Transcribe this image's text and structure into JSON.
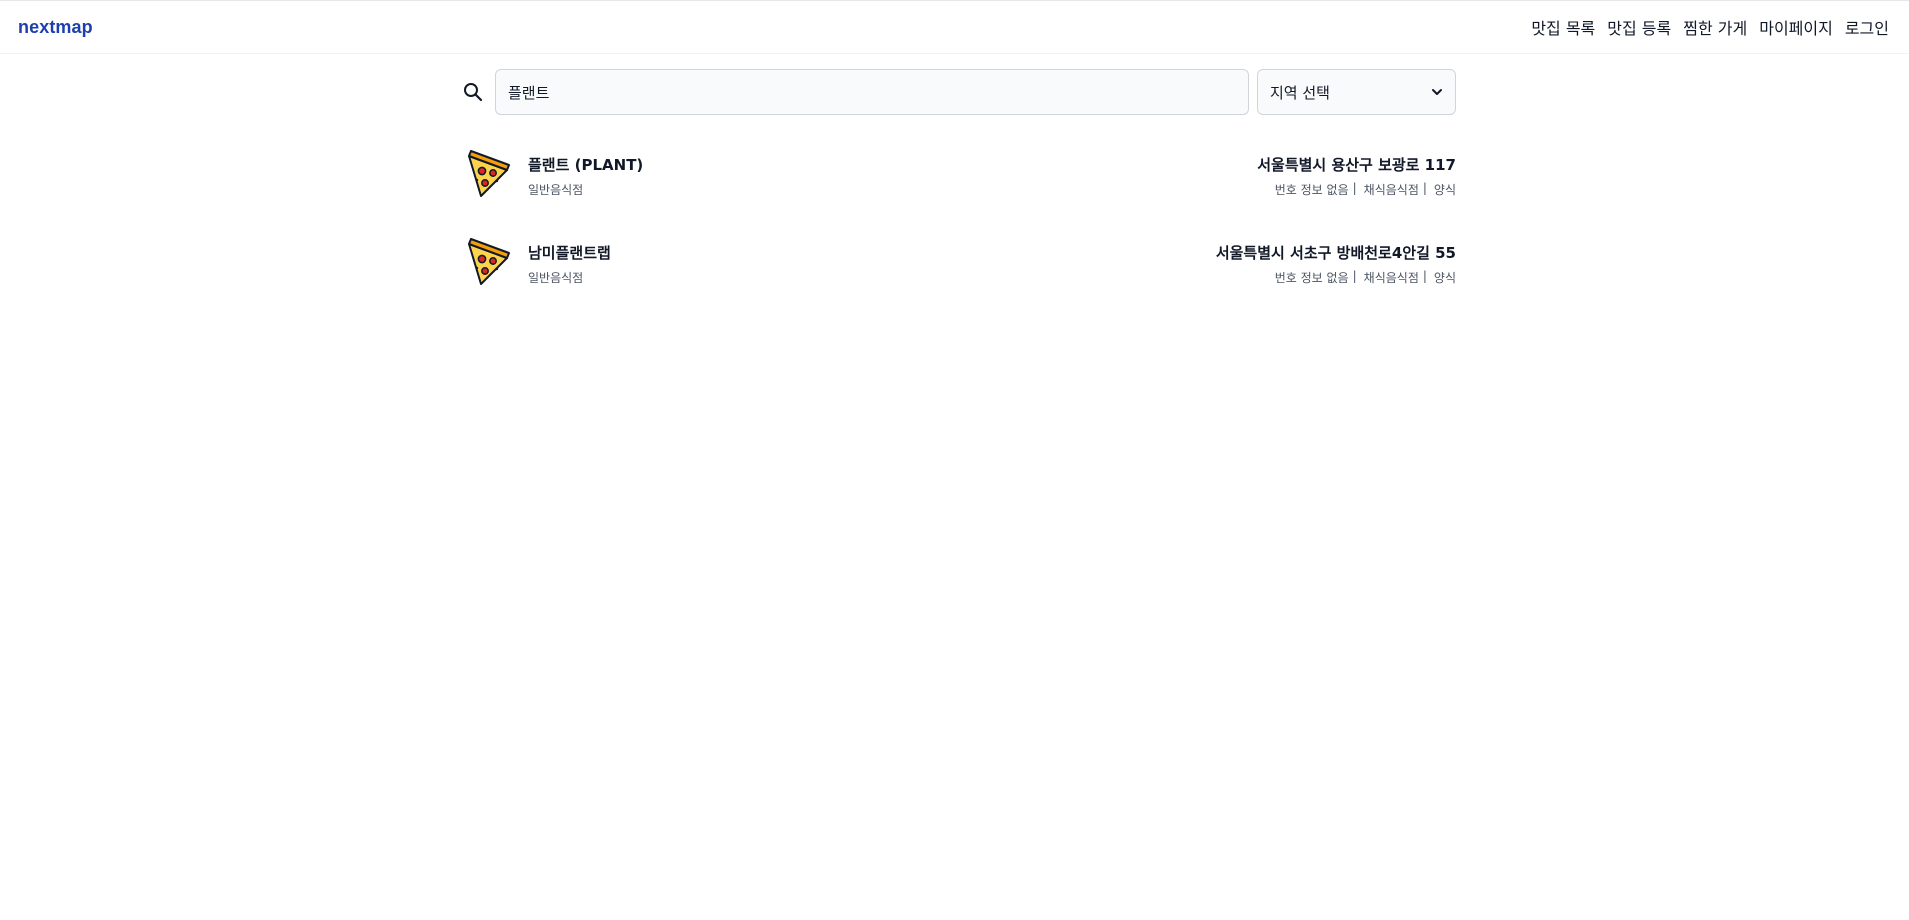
{
  "header": {
    "logo": "nextmap",
    "nav": [
      {
        "label": "맛집 목록"
      },
      {
        "label": "맛집 등록"
      },
      {
        "label": "찜한 가게"
      },
      {
        "label": "마이페이지"
      },
      {
        "label": "로그인"
      }
    ]
  },
  "search": {
    "value": "플랜트",
    "region_select": {
      "selected": "지역 선택"
    }
  },
  "results": [
    {
      "icon": "pizza-icon",
      "name": "플랜트 (PLANT)",
      "category": "일반음식점",
      "address": "서울특별시 용산구 보광로 117",
      "phone": "번호 정보 없음",
      "food_type": "채식음식점",
      "cuisine": "양식"
    },
    {
      "icon": "pizza-icon",
      "name": "남미플랜트랩",
      "category": "일반음식점",
      "address": "서울특별시 서초구 방배천로4안길 55",
      "phone": "번호 정보 없음",
      "food_type": "채식음식점",
      "cuisine": "양식"
    }
  ],
  "colors": {
    "brand": "#1e40af",
    "input_bg": "#f9fafb",
    "border": "#d1d5db",
    "pizza_cheese": "#fcd34d",
    "pizza_crust": "#f59e0b",
    "pepperoni": "#dc2626"
  }
}
